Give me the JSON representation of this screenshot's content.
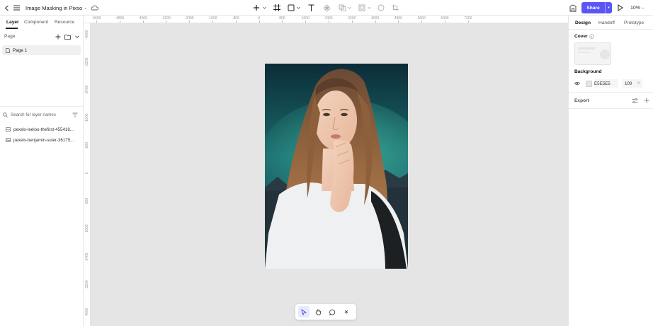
{
  "topbar": {
    "file_title": "Image Masking in Pixso",
    "share_label": "Share",
    "zoom": "10%"
  },
  "left_panel": {
    "tabs": [
      "Layer",
      "Component",
      "Resource"
    ],
    "page_header": "Page",
    "pages": [
      "Page 1"
    ],
    "search_placeholder": "Search for layer names",
    "layers": [
      "pexels-leeloo-thefirst-455418...",
      "pexels-benjamin-suter-36175..."
    ]
  },
  "rulers": {
    "horizontal": [
      "-5600",
      "-4800",
      "-4000",
      "-3200",
      "-2400",
      "-1600",
      "-800",
      "0",
      "800",
      "1600",
      "2400",
      "3200",
      "4000",
      "4800",
      "5600",
      "6400",
      "7200"
    ],
    "vertical": [
      "-4000",
      "-3200",
      "-2400",
      "-1600",
      "-800",
      "0",
      "800",
      "1600",
      "2400",
      "3200",
      "4000"
    ]
  },
  "right_panel": {
    "tabs": [
      "Design",
      "Handoff",
      "Prototype"
    ],
    "cover_label": "Cover",
    "background_label": "Background",
    "background_hex": "E5E5E5",
    "background_opacity": "100",
    "opacity_unit": "%",
    "export_label": "Export"
  },
  "help_label": "?",
  "colors": {
    "accent": "#5a55f5",
    "canvas": "#e5e5e5"
  }
}
